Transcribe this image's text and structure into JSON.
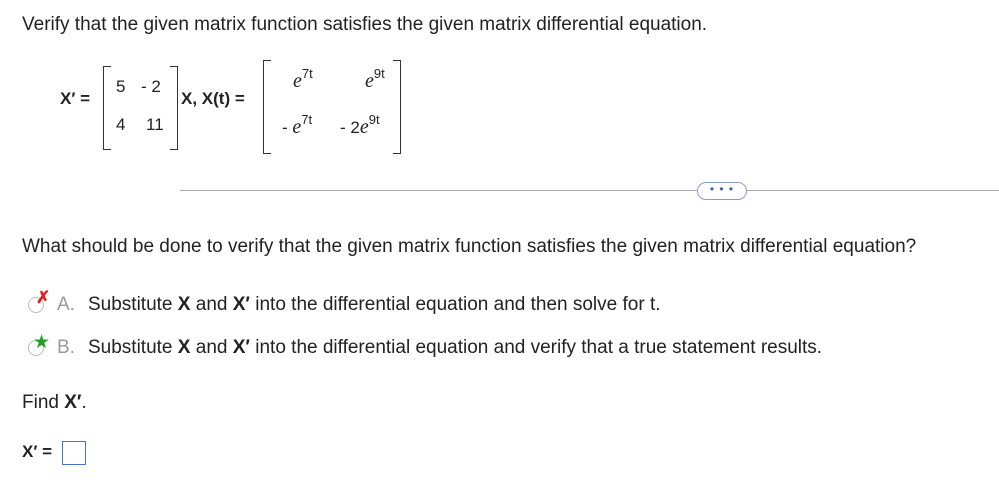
{
  "question": "Verify that the given matrix function satisfies the given matrix differential equation.",
  "equation": {
    "lhs": "X′ =",
    "coef_matrix": [
      [
        "5",
        "- 2"
      ],
      [
        "4",
        "11"
      ]
    ],
    "mid_text": "X,  X(t) =",
    "xt_matrix": {
      "r1c1": {
        "base": "e",
        "exp": "7t",
        "prefix": ""
      },
      "r1c2": {
        "base": "e",
        "exp": "9t",
        "prefix": ""
      },
      "r2c1": {
        "base": "e",
        "exp": "7t",
        "prefix": "- "
      },
      "r2c2": {
        "base": "e",
        "exp": "9t",
        "prefix": "- 2"
      }
    }
  },
  "more_button": "• • •",
  "prompt": "What should be done to verify that the given matrix function satisfies the given matrix differential equation?",
  "options": [
    {
      "letter": "A.",
      "text_pre": "Substitute ",
      "bold1": "X",
      "text_mid": " and ",
      "bold2": "X′",
      "text_post": " into the differential equation and then solve for t.",
      "mark": "incorrect"
    },
    {
      "letter": "B.",
      "text_pre": "Substitute ",
      "bold1": "X",
      "text_mid": " and ",
      "bold2": "X′",
      "text_post": " into the differential equation and verify that a true statement results.",
      "mark": "correct"
    }
  ],
  "find": {
    "pre": "Find ",
    "bold": "X′",
    "post": "."
  },
  "answer_label": "X′ =",
  "colors": {
    "incorrect": "#e02020",
    "correct": "#25a025",
    "input_border": "#4a70c9"
  }
}
